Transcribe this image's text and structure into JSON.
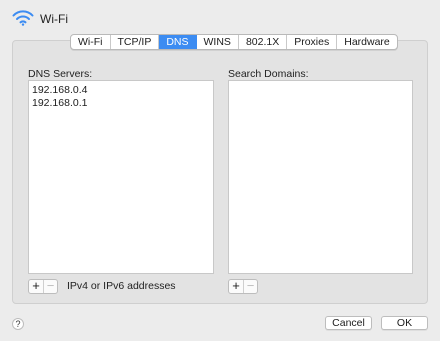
{
  "header": {
    "title": "Wi-Fi",
    "icon": "wifi-icon"
  },
  "tabs": [
    {
      "label": "Wi-Fi",
      "active": false
    },
    {
      "label": "TCP/IP",
      "active": false
    },
    {
      "label": "DNS",
      "active": true
    },
    {
      "label": "WINS",
      "active": false
    },
    {
      "label": "802.1X",
      "active": false
    },
    {
      "label": "Proxies",
      "active": false
    },
    {
      "label": "Hardware",
      "active": false
    }
  ],
  "dns": {
    "label": "DNS Servers:",
    "servers": [
      "192.168.0.4",
      "192.168.0.1"
    ],
    "add": "+",
    "remove": "−",
    "hint": "IPv4 or IPv6 addresses"
  },
  "search": {
    "label": "Search Domains:",
    "domains": [],
    "add": "+",
    "remove": "−"
  },
  "footer": {
    "help": "?",
    "cancel": "Cancel",
    "ok": "OK"
  },
  "colors": {
    "accent": "#3c8cf2",
    "window_bg": "#ececec",
    "panel_bg": "#e3e3e3"
  }
}
